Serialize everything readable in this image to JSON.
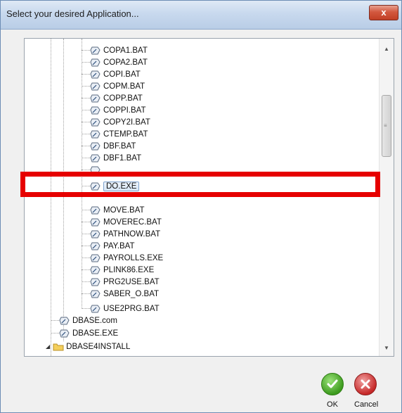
{
  "window": {
    "title": "Select your desired Application...",
    "close_label": "x"
  },
  "tree": {
    "items": [
      {
        "label": "COPA1.BAT",
        "icon": "shortcut-icon"
      },
      {
        "label": "COPA2.BAT",
        "icon": "shortcut-icon"
      },
      {
        "label": "COPI.BAT",
        "icon": "shortcut-icon"
      },
      {
        "label": "COPM.BAT",
        "icon": "shortcut-icon"
      },
      {
        "label": "COPP.BAT",
        "icon": "shortcut-icon"
      },
      {
        "label": "COPPI.BAT",
        "icon": "shortcut-icon"
      },
      {
        "label": "COPY2I.BAT",
        "icon": "shortcut-icon"
      },
      {
        "label": "CTEMP.BAT",
        "icon": "shortcut-icon"
      },
      {
        "label": "DBF.BAT",
        "icon": "shortcut-icon"
      },
      {
        "label": "DBF1.BAT",
        "icon": "shortcut-icon"
      },
      {
        "label": "DO.EXE",
        "icon": "shortcut-icon",
        "selected": true
      },
      {
        "label": "MOVE.BAT",
        "icon": "shortcut-icon"
      },
      {
        "label": "MOVEREC.BAT",
        "icon": "shortcut-icon"
      },
      {
        "label": "PATHNOW.BAT",
        "icon": "shortcut-icon"
      },
      {
        "label": "PAY.BAT",
        "icon": "shortcut-icon"
      },
      {
        "label": "PAYROLLS.EXE",
        "icon": "shortcut-icon"
      },
      {
        "label": "PLINK86.EXE",
        "icon": "shortcut-icon"
      },
      {
        "label": "PRG2USE.BAT",
        "icon": "shortcut-icon"
      },
      {
        "label": "SABER_O.BAT",
        "icon": "shortcut-icon"
      },
      {
        "label": "USE2PRG.BAT",
        "icon": "shortcut-icon"
      },
      {
        "label": "DBASE.com",
        "icon": "shortcut-icon"
      },
      {
        "label": "DBASE.EXE",
        "icon": "shortcut-icon"
      },
      {
        "label": "DBASE4INSTALL",
        "icon": "folder-icon"
      }
    ]
  },
  "buttons": {
    "ok_label": "OK",
    "cancel_label": "Cancel"
  },
  "colors": {
    "highlight_border": "#e60000",
    "ok_green": "#3d9b1e",
    "cancel_red": "#c62828"
  }
}
